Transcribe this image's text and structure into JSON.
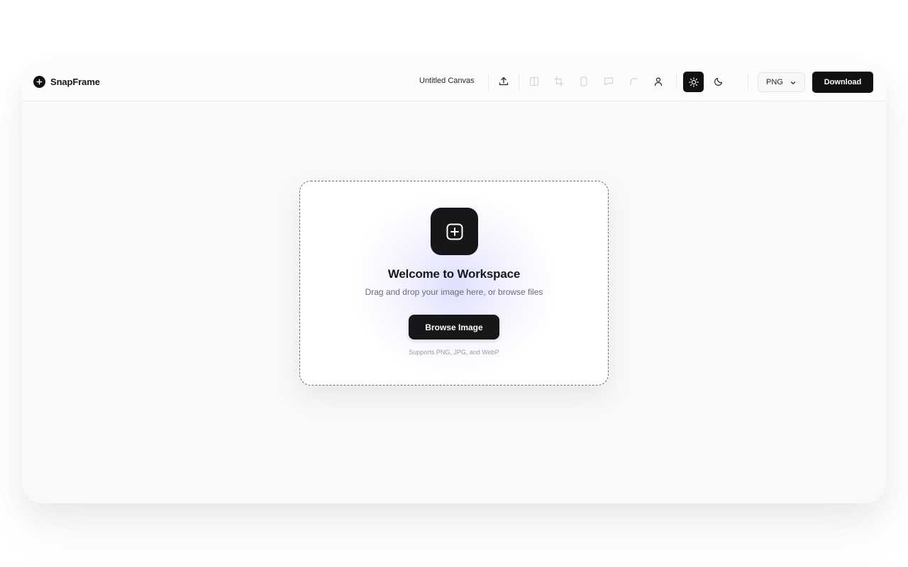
{
  "app": {
    "name": "SnapFrame"
  },
  "toolbar": {
    "canvas_title": "Untitled Canvas",
    "tools": [
      {
        "icon": "upload-icon",
        "enabled": true
      },
      {
        "icon": "split-view-icon",
        "enabled": false
      },
      {
        "icon": "crop-icon",
        "enabled": false
      },
      {
        "icon": "device-frame-icon",
        "enabled": false
      },
      {
        "icon": "comment-icon",
        "enabled": false
      },
      {
        "icon": "corner-radius-icon",
        "enabled": false
      },
      {
        "icon": "user-icon",
        "enabled": true
      },
      {
        "icon": "sun-icon",
        "enabled": true,
        "active": true
      },
      {
        "icon": "moon-icon",
        "enabled": true
      }
    ],
    "format_value": "PNG",
    "download_label": "Download"
  },
  "dropzone": {
    "title": "Welcome to Workspace",
    "subtitle": "Drag and drop your image here, or browse files",
    "button_label": "Browse Image",
    "note": "Supports PNG, JPG, and WebP"
  },
  "colors": {
    "accent": "#111114",
    "background": "#f8f9fb",
    "glow": "#c4c4ff"
  }
}
